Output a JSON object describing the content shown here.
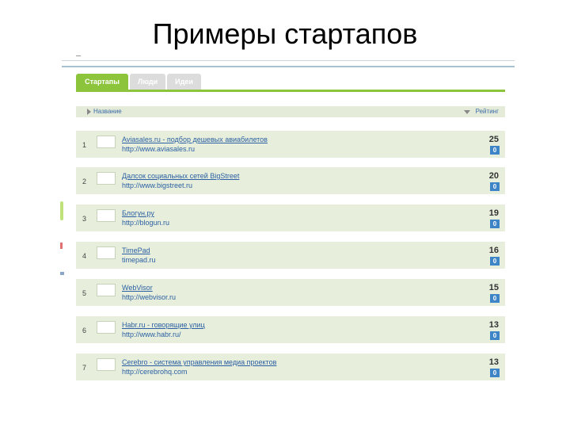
{
  "slide": {
    "title": "Примеры стартапов"
  },
  "tabs": [
    {
      "label": "Стартапы",
      "active": true
    },
    {
      "label": "Люди",
      "active": false
    },
    {
      "label": "Идеи",
      "active": false
    }
  ],
  "header": {
    "name": "Название",
    "rating": "Рейтинг"
  },
  "rows": [
    {
      "num": "1",
      "title": "Aviasales.ru - подбор дешевых авиабилетов",
      "url": "http://www.aviasales.ru",
      "score": "25",
      "comments": "0"
    },
    {
      "num": "2",
      "title": "Далсок социальных сетей BigStreet",
      "url": "http://www.bigstreet.ru",
      "score": "20",
      "comments": "0"
    },
    {
      "num": "3",
      "title": "Блогун.ру",
      "url": "http://blogun.ru",
      "score": "19",
      "comments": "0"
    },
    {
      "num": "4",
      "title": "TimePad",
      "url": "timepad.ru",
      "score": "16",
      "comments": "0"
    },
    {
      "num": "5",
      "title": "WebVisor",
      "url": "http://webvisor.ru",
      "score": "15",
      "comments": "0"
    },
    {
      "num": "6",
      "title": "Habr.ru - говорящие улиц",
      "url": "http://www.habr.ru/",
      "score": "13",
      "comments": "0"
    },
    {
      "num": "7",
      "title": "Cerebro - система управления медиа проектов",
      "url": "http://cerebrohq.com",
      "score": "13",
      "comments": "0"
    }
  ],
  "colors": {
    "accent": "#8cc43c",
    "row_bg": "#e7efdc",
    "link": "#2b5fa3",
    "badge": "#3e85c8"
  }
}
